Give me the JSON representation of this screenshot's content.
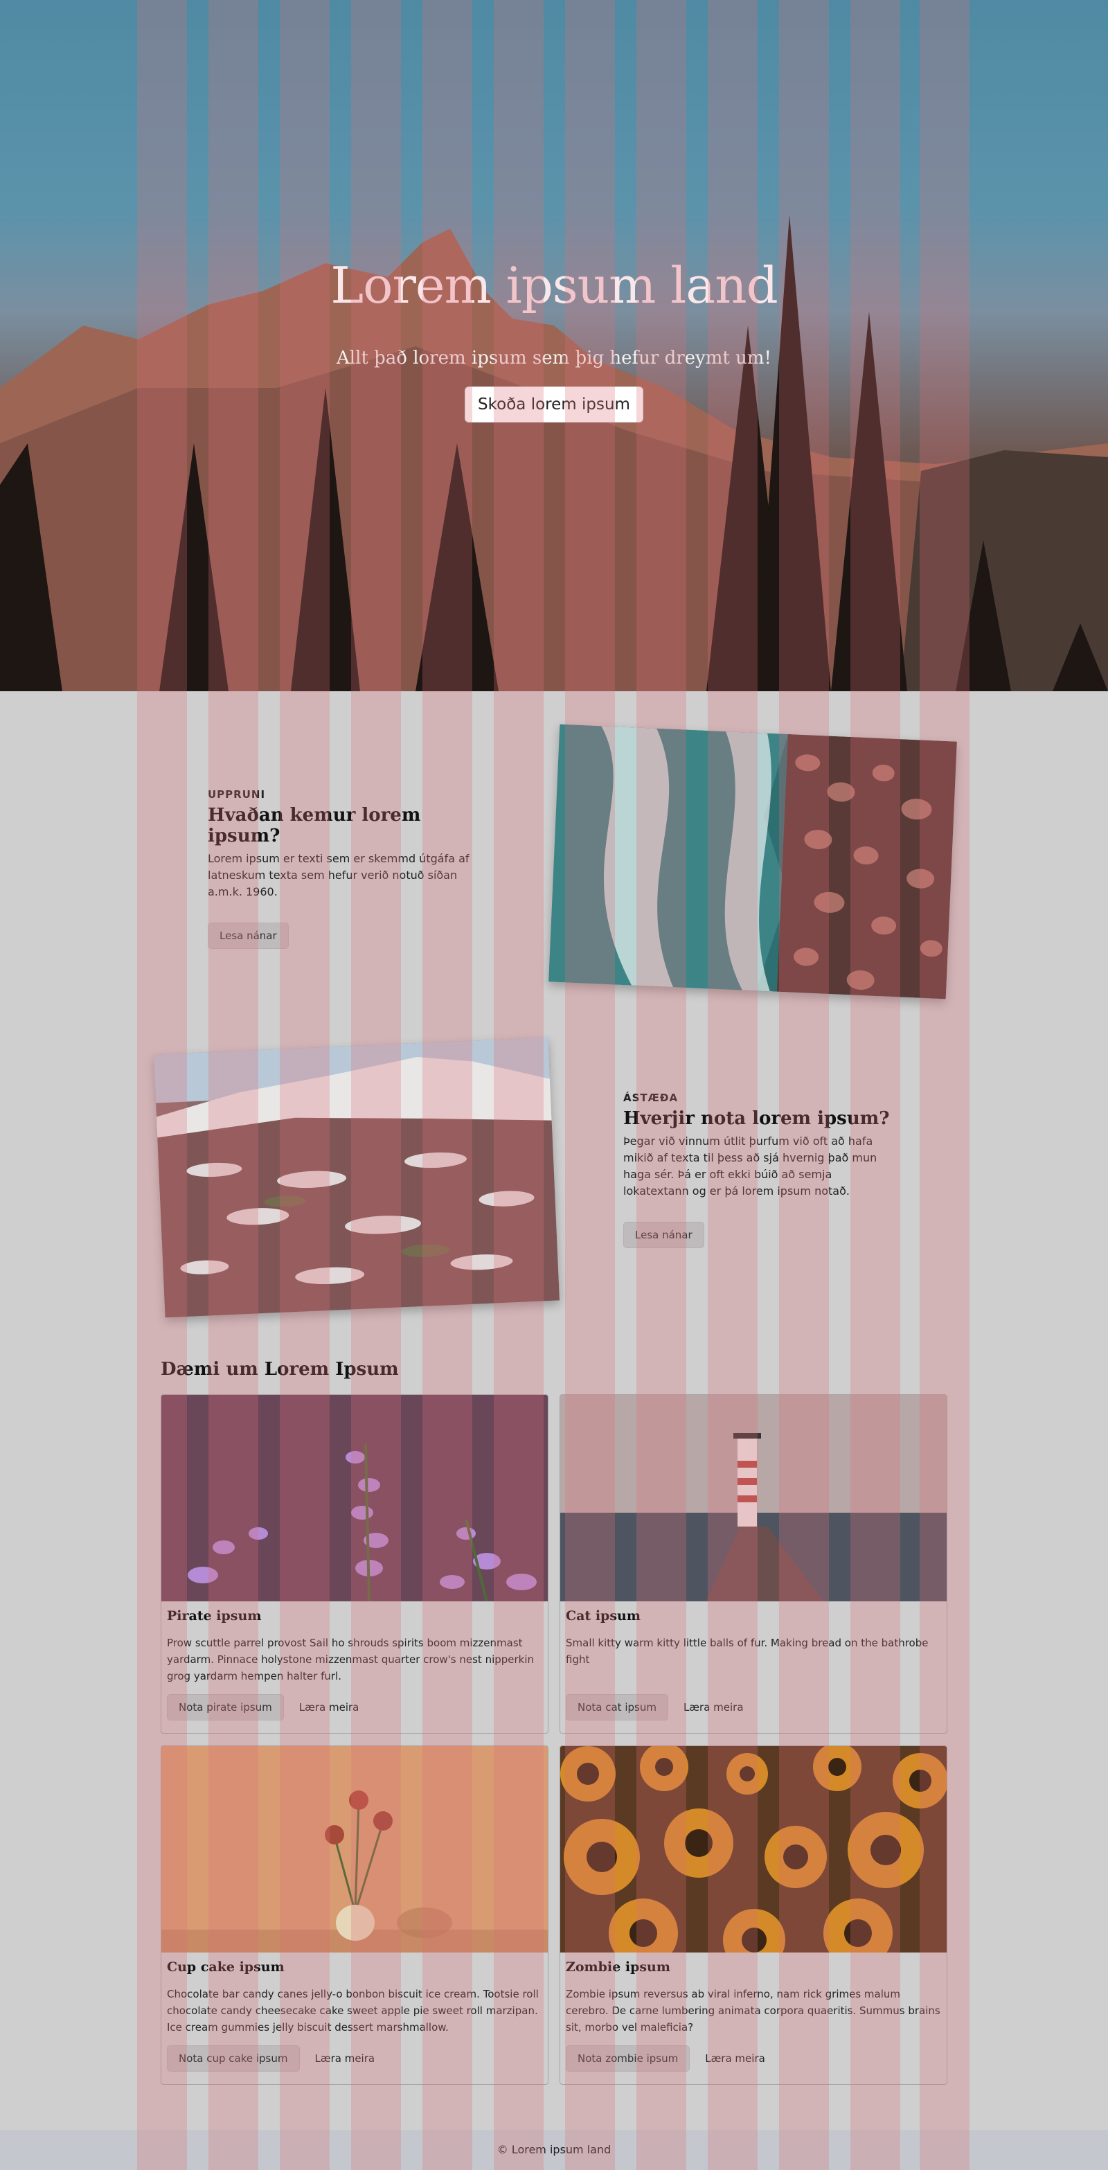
{
  "hero": {
    "title": "Lorem ipsum land",
    "subtitle": "Allt það lorem ipsum sem þig hefur dreymt um!",
    "button": "Skoða lorem ipsum"
  },
  "feature1": {
    "eyebrow": "UPPRUNI",
    "title": "Hvaðan kemur lorem ipsum?",
    "body": "Lorem ipsum er texti sem er skemmd útgáfa af latneskum texta sem hefur verið notuð síðan a.m.k. 1960.",
    "button": "Lesa nánar"
  },
  "feature2": {
    "eyebrow": "ÁSTÆÐA",
    "title": "Hverjir nota lorem ipsum?",
    "body": "Þegar við vinnum útlit þurfum við oft að hafa mikið af texta til þess að sjá hvernig það mun haga sér. Þá er oft ekki búið að semja lokatextann og er þá lorem ipsum notað.",
    "button": "Lesa nánar"
  },
  "examples": {
    "title": "Dæmi um Lorem Ipsum",
    "cards": [
      {
        "title": "Pirate ipsum",
        "text": "Prow scuttle parrel provost Sail ho shrouds spirits boom mizzenmast yardarm. Pinnace holystone mizzenmast quarter crow's nest nipperkin grog yardarm hempen halter furl.",
        "button": "Nota pirate ipsum",
        "link": "Læra meira"
      },
      {
        "title": "Cat ipsum",
        "text": "Small kitty warm kitty little balls of fur. Making bread on the bathrobe fight",
        "button": "Nota cat ipsum",
        "link": "Læra meira"
      },
      {
        "title": "Cup cake ipsum",
        "text": "Chocolate bar candy canes jelly-o bonbon biscuit ice cream. Tootsie roll chocolate candy cheesecake cake sweet apple pie sweet roll marzipan. Ice cream gummies jelly biscuit dessert marshmallow.",
        "button": "Nota cup cake ipsum",
        "link": "Læra meira"
      },
      {
        "title": "Zombie ipsum",
        "text": "Zombie ipsum reversus ab viral inferno, nam rick grimes malum cerebro. De carne lumbering animata corpora quaeritis. Summus brains sit, morbo vel maleficia?",
        "button": "Nota zombie ipsum",
        "link": "Læra meira"
      }
    ]
  },
  "footer": {
    "text": "© Lorem ipsum land"
  }
}
